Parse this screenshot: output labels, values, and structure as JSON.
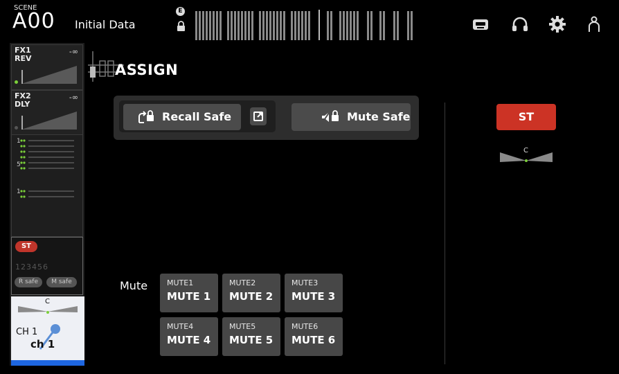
{
  "colors": {
    "accent_red": "#cc3325",
    "channel_blue": "#1e66e0",
    "led_green": "#7bcf3a"
  },
  "header": {
    "scene_tag": "SCENE",
    "scene_number": "A00",
    "scene_name": "Initial Data",
    "lock_badge": "E",
    "icons": [
      "recorder-icon",
      "headphones-icon",
      "gear-icon",
      "user-icon"
    ]
  },
  "fx": [
    {
      "name_line1": "FX1",
      "name_line2": "REV",
      "level": "-∞"
    },
    {
      "name_line1": "FX2",
      "name_line2": "DLY",
      "level": "-∞"
    }
  ],
  "strip": {
    "meter_labels": [
      "1",
      "5",
      "1"
    ],
    "st_label": "ST",
    "mute_groups": "123456",
    "recall_safe_pill": "R safe",
    "mute_safe_pill": "M safe",
    "pan_center": "C",
    "channel_number": "CH 1",
    "channel_name": "ch 1"
  },
  "assign": {
    "title": "ASSIGN",
    "recall_safe": "Recall Safe",
    "mute_safe": "Mute Safe",
    "st_label": "ST",
    "st_pan_center": "C",
    "mute_label": "Mute",
    "mutes": [
      {
        "sub": "MUTE1",
        "main": "MUTE 1"
      },
      {
        "sub": "MUTE2",
        "main": "MUTE 2"
      },
      {
        "sub": "MUTE3",
        "main": "MUTE 3"
      },
      {
        "sub": "MUTE4",
        "main": "MUTE 4"
      },
      {
        "sub": "MUTE5",
        "main": "MUTE 5"
      },
      {
        "sub": "MUTE6",
        "main": "MUTE 6"
      }
    ]
  }
}
